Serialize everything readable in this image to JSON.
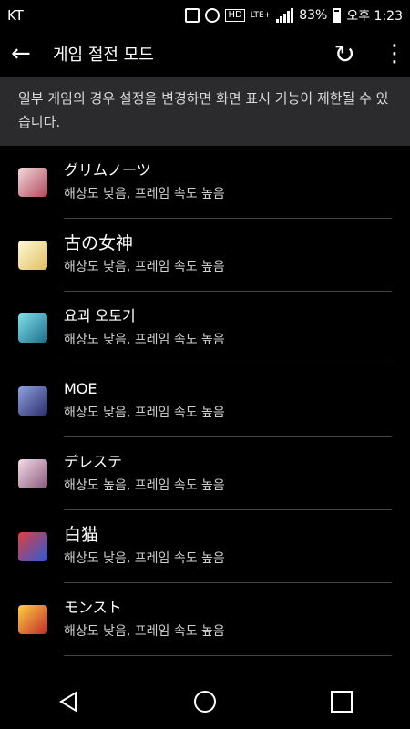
{
  "status_bar": {
    "carrier": "KT",
    "hd": "HD",
    "network": "LTE+",
    "battery": "83%",
    "time": "오후 1:23"
  },
  "app_bar": {
    "title": "게임 절전 모드",
    "back_icon": "arrow-left-icon",
    "refresh_icon": "refresh-icon",
    "more_icon": "more-vertical-icon"
  },
  "notice": "일부 게임의 경우 설정을 변경하면 화면 표시 기능이 제한될 수 있습니다.",
  "games": [
    {
      "name": "グリムノーツ",
      "setting": "해상도 낮음, 프레임 속도 높음",
      "icon_color": "#c9a0a8"
    },
    {
      "name": "古の女神",
      "setting": "해상도 낮음, 프레임 속도 높음",
      "icon_color": "#f0e6b8"
    },
    {
      "name": "요괴 오토기",
      "setting": "해상도 낮음, 프레임 속도 높음",
      "icon_color": "#3aa9b8"
    },
    {
      "name": "MOE",
      "setting": "해상도 낮음, 프레임 속도 높음",
      "icon_color": "#5a6fb8"
    },
    {
      "name": "デレステ",
      "setting": "해상도 높음, 프레임 속도 높음",
      "icon_color": "#d8b4c8"
    },
    {
      "name": "白猫",
      "setting": "해상도 낮음, 프레임 속도 높음",
      "icon_color": "#3d6fd0"
    },
    {
      "name": "モンスト",
      "setting": "해상도 낮음, 프레임 속도 높음",
      "icon_color": "#d84a3a"
    }
  ]
}
